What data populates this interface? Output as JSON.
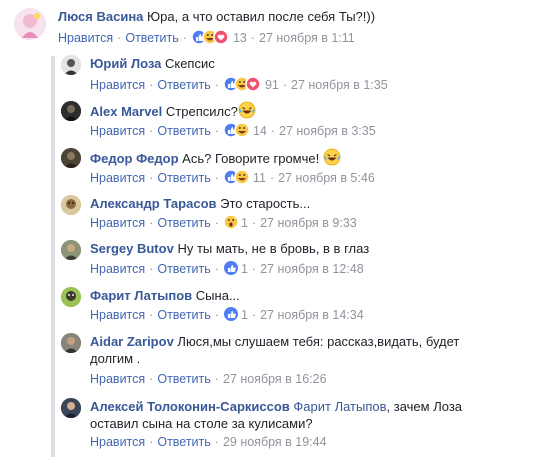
{
  "comments": [
    {
      "author": "Люся Васина",
      "text": "Юра, а что оставил после себя Ты?!))",
      "like": "Нравится",
      "reply": "Ответить",
      "reactions": [
        "like",
        "haha",
        "love"
      ],
      "count": "13",
      "time": "27 ноября в 1:11",
      "avatar_color": "#f3d6e8"
    },
    {
      "author": "Юрий Лоза",
      "text": "Скепсис",
      "like": "Нравится",
      "reply": "Ответить",
      "reactions": [
        "like",
        "haha",
        "love"
      ],
      "count": "91",
      "time": "27 ноября в 1:35",
      "avatar_color": "#d8d8d8"
    },
    {
      "author": "Alex Marvel",
      "text": "Стрепсилс?",
      "emoji_after": "laugh",
      "like": "Нравится",
      "reply": "Ответить",
      "reactions": [
        "like",
        "haha"
      ],
      "count": "14",
      "time": "27 ноября в 3:35",
      "avatar_color": "#3a3a3a"
    },
    {
      "author": "Федор Федор",
      "text": "Ась? Говорите громче!",
      "emoji_after": "laugh",
      "like": "Нравится",
      "reply": "Ответить",
      "reactions": [
        "like",
        "haha"
      ],
      "count": "11",
      "time": "27 ноября в 5:46",
      "avatar_color": "#4a4436"
    },
    {
      "author": "Александр Тарасов",
      "text": "Это старость...",
      "like": "Нравится",
      "reply": "Ответить",
      "reactions": [
        "wow"
      ],
      "count": "1",
      "time": "27 ноября в 9:33",
      "avatar_color": "#c9b48a"
    },
    {
      "author": "Sergey Butov",
      "text": "Ну ты мать, не в бровь, в в глаз",
      "like": "Нравится",
      "reply": "Ответить",
      "reactions": [
        "like"
      ],
      "count": "1",
      "time": "27 ноября в 12:48",
      "avatar_color": "#7d8a6a"
    },
    {
      "author": "Фарит Латыпов",
      "text": "Сына...",
      "like": "Нравится",
      "reply": "Ответить",
      "reactions": [
        "like"
      ],
      "count": "1",
      "time": "27 ноября в 14:34",
      "avatar_color": "#8fb34a"
    },
    {
      "author": "Aidar Zaripov",
      "text_line1": "Люся,мы слушаем тебя: рассказ,видать, будет",
      "text_line2": "долгим .",
      "like": "Нравится",
      "reply": "Ответить",
      "time": "27 ноября в 16:26",
      "avatar_color": "#6e6a60"
    },
    {
      "author": "Алексей Толоконин-Саркиссов",
      "tag": "Фарит Латыпов",
      "text_line1": ", зачем Лоза",
      "text_line2": "оставил сына на столе за кулисами?",
      "like": "Нравится",
      "reply": "Ответить",
      "time": "29 ноября в 19:44",
      "avatar_color": "#2f3a4a"
    }
  ]
}
